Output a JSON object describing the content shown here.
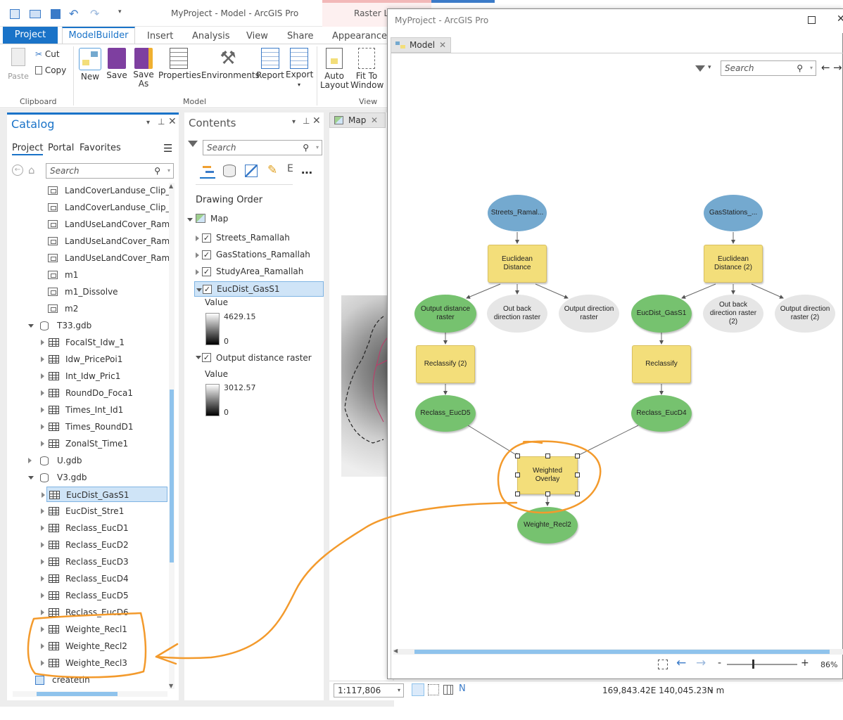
{
  "window": {
    "title": "MyProject - Model - ArcGIS Pro",
    "context_tab": "Raster La"
  },
  "ribbon": {
    "tabs": [
      "Project",
      "ModelBuilder",
      "Insert",
      "Analysis",
      "View",
      "Share",
      "Appearance"
    ],
    "active_tab": "ModelBuilder",
    "clipboard": {
      "paste": "Paste",
      "cut": "Cut",
      "copy": "Copy",
      "group": "Clipboard"
    },
    "model": {
      "new": "New",
      "save": "Save",
      "save_as_1": "Save",
      "save_as_2": "As",
      "properties": "Properties",
      "environments": "Environments",
      "report": "Report",
      "export": "Export",
      "group": "Model"
    },
    "view": {
      "auto_layout_1": "Auto",
      "auto_layout_2": "Layout",
      "fit_1": "Fit To",
      "fit_2": "Window",
      "group": "View"
    }
  },
  "catalog": {
    "title": "Catalog",
    "tabs": [
      "Project",
      "Portal",
      "Favorites"
    ],
    "search_placeholder": "Search",
    "items": [
      {
        "label": "LandCoverLanduse_Clip_Di",
        "kind": "raster"
      },
      {
        "label": "LandCoverLanduse_Clip_Di",
        "kind": "raster"
      },
      {
        "label": "LandUseLandCover_Ramall",
        "kind": "raster"
      },
      {
        "label": "LandUseLandCover_Ramall",
        "kind": "raster"
      },
      {
        "label": "LandUseLandCover_Ramall",
        "kind": "raster"
      },
      {
        "label": "m1",
        "kind": "raster"
      },
      {
        "label": "m1_Dissolve",
        "kind": "raster"
      },
      {
        "label": "m2",
        "kind": "raster"
      },
      {
        "label": "T33.gdb",
        "kind": "gdb"
      },
      {
        "label": "FocalSt_Idw_1",
        "kind": "grid"
      },
      {
        "label": "Idw_PricePoi1",
        "kind": "grid"
      },
      {
        "label": "Int_Idw_Pric1",
        "kind": "grid"
      },
      {
        "label": "RoundDo_Foca1",
        "kind": "grid"
      },
      {
        "label": "Times_Int_Id1",
        "kind": "grid"
      },
      {
        "label": "Times_RoundD1",
        "kind": "grid"
      },
      {
        "label": "ZonalSt_Time1",
        "kind": "grid"
      },
      {
        "label": "U.gdb",
        "kind": "gdb-closed"
      },
      {
        "label": "V3.gdb",
        "kind": "gdb"
      },
      {
        "label": "EucDist_GasS1",
        "kind": "grid-selected"
      },
      {
        "label": "EucDist_Stre1",
        "kind": "grid"
      },
      {
        "label": "Reclass_EucD1",
        "kind": "grid"
      },
      {
        "label": "Reclass_EucD2",
        "kind": "grid"
      },
      {
        "label": "Reclass_EucD3",
        "kind": "grid"
      },
      {
        "label": "Reclass_EucD4",
        "kind": "grid"
      },
      {
        "label": "Reclass_EucD5",
        "kind": "grid"
      },
      {
        "label": "Reclass_EucD6",
        "kind": "grid"
      },
      {
        "label": "Weighte_Recl1",
        "kind": "grid"
      },
      {
        "label": "Weighte_Recl2",
        "kind": "grid"
      },
      {
        "label": "Weighte_Recl3",
        "kind": "grid"
      },
      {
        "label": "createtin",
        "kind": "tin"
      }
    ]
  },
  "contents": {
    "title": "Contents",
    "search_placeholder": "Search",
    "drawing_order": "Drawing Order",
    "map_label": "Map",
    "layers": [
      "Streets_Ramallah",
      "GasStations_Ramallah",
      "StudyArea_Ramallah",
      "EucDist_GasS1"
    ],
    "legend1": {
      "label": "Value",
      "max": "4629.15",
      "min": "0"
    },
    "layer5": "Output distance raster",
    "legend2": {
      "label": "Value",
      "max": "3012.57",
      "min": "0"
    }
  },
  "map_tab": {
    "label": "Map",
    "scale": "1:117,806",
    "coords": "169,843.42E 140,045.23N m"
  },
  "model_window": {
    "title": "MyProject - ArcGIS Pro",
    "tab": "Model",
    "search_placeholder": "Search",
    "zoom": "86%",
    "nodes": {
      "streets": "Streets_Ramal...",
      "gas": "GasStations_...",
      "euc1_a": "Euclidean",
      "euc1_b": "Distance",
      "euc2_a": "Euclidean",
      "euc2_b": "Distance (2)",
      "odr1_a": "Output distance",
      "odr1_b": "raster",
      "obdr1_a": "Out back",
      "obdr1_b": "direction raster",
      "odir1_a": "Output direction",
      "odir1_b": "raster",
      "eucgas": "EucDist_GasS1",
      "obdr2_a": "Out back",
      "obdr2_b": "direction raster",
      "obdr2_c": "(2)",
      "odir2_a": "Output direction",
      "odir2_b": "raster (2)",
      "reclass2": "Reclassify (2)",
      "reclass": "Reclassify",
      "eucd5": "Reclass_EucD5",
      "eucd4": "Reclass_EucD4",
      "wo_a": "Weighted",
      "wo_b": "Overlay",
      "wrecl2": "Weighte_Recl2"
    }
  },
  "colors": {
    "accent": "#1a73c8",
    "annotation": "#f39a2c",
    "tool": "#f3de7a",
    "data_green": "#76c26f",
    "input_blue": "#74a9cf"
  }
}
